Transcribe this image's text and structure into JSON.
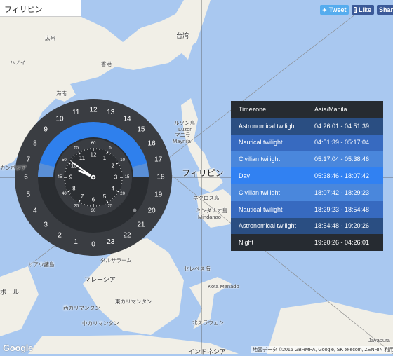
{
  "search": {
    "value": "フィリピン"
  },
  "social": {
    "tweet": "Tweet",
    "like": "Like",
    "share": "Share"
  },
  "timezone": {
    "header_label": "Timezone",
    "header_value": "Asia/Manila",
    "rows": [
      {
        "name": "Astronomical twilight",
        "range": "04:26:01 - 04:51:39",
        "color": "#2a4e82"
      },
      {
        "name": "Nautical twilight",
        "range": "04:51:39 - 05:17:04",
        "color": "#376ac0"
      },
      {
        "name": "Civilian twilight",
        "range": "05:17:04 - 05:38:46",
        "color": "#4a87dc"
      },
      {
        "name": "Day",
        "range": "05:38:46 - 18:07:42",
        "color": "#3181f2"
      },
      {
        "name": "Civilian twilight",
        "range": "18:07:42 - 18:29:23",
        "color": "#4a87dc"
      },
      {
        "name": "Nautical twilight",
        "range": "18:29:23 - 18:54:48",
        "color": "#376ac0"
      },
      {
        "name": "Astronomical twilight",
        "range": "18:54:48 - 19:20:26",
        "color": "#2a4e82"
      },
      {
        "name": "Night",
        "range": "19:20:26 - 04:26:01",
        "color": "#262b31"
      }
    ]
  },
  "dial": {
    "hours": [
      "0",
      "1",
      "2",
      "3",
      "4",
      "5",
      "6",
      "7",
      "8",
      "9",
      "10",
      "11",
      "12",
      "13",
      "14",
      "15",
      "16",
      "17",
      "18",
      "19",
      "20",
      "21",
      "22",
      "23"
    ],
    "inner_hours": [
      "12",
      "1",
      "2",
      "3",
      "4",
      "5",
      "6",
      "7",
      "8",
      "9",
      "10",
      "11"
    ],
    "inner_minutes": [
      "60",
      "5",
      "10",
      "15",
      "20",
      "25",
      "30",
      "35",
      "40",
      "45",
      "50",
      "55"
    ],
    "current_time": {
      "hour": 9,
      "minute": 50,
      "second": 51
    }
  },
  "map_labels": [
    {
      "text": "台湾",
      "cls": "mid"
    },
    {
      "text": "広州",
      "cls": ""
    },
    {
      "text": "香港",
      "cls": ""
    },
    {
      "text": "海南",
      "cls": ""
    },
    {
      "text": "ハノイ",
      "cls": ""
    },
    {
      "text": "ルソン島",
      "cls": ""
    },
    {
      "text": "Luzon",
      "cls": ""
    },
    {
      "text": "マニラ",
      "cls": ""
    },
    {
      "text": "Maynila",
      "cls": ""
    },
    {
      "text": "フィリピン",
      "cls": "big"
    },
    {
      "text": "ネグロス島",
      "cls": ""
    },
    {
      "text": "ミンダナオ島",
      "cls": ""
    },
    {
      "text": "Mindanao",
      "cls": ""
    },
    {
      "text": "ダルサラーム",
      "cls": ""
    },
    {
      "text": "マレーシア",
      "cls": "mid"
    },
    {
      "text": "セレベス海",
      "cls": ""
    },
    {
      "text": "Kota Manado",
      "cls": ""
    },
    {
      "text": "西カリマンタン",
      "cls": ""
    },
    {
      "text": "中カリマンタン",
      "cls": ""
    },
    {
      "text": "東カリマンタン",
      "cls": ""
    },
    {
      "text": "北スラウェシ",
      "cls": ""
    },
    {
      "text": "インドネシア",
      "cls": "mid"
    },
    {
      "text": "ポール",
      "cls": "mid"
    },
    {
      "text": "リアウ諸島",
      "cls": ""
    },
    {
      "text": "カンボジア",
      "cls": ""
    },
    {
      "text": "Jayapura",
      "cls": ""
    }
  ],
  "attribution": "地図データ ©2016 GBRMPA, Google, SK telecom, ZENRIN  利用規",
  "google_logo": "Google"
}
